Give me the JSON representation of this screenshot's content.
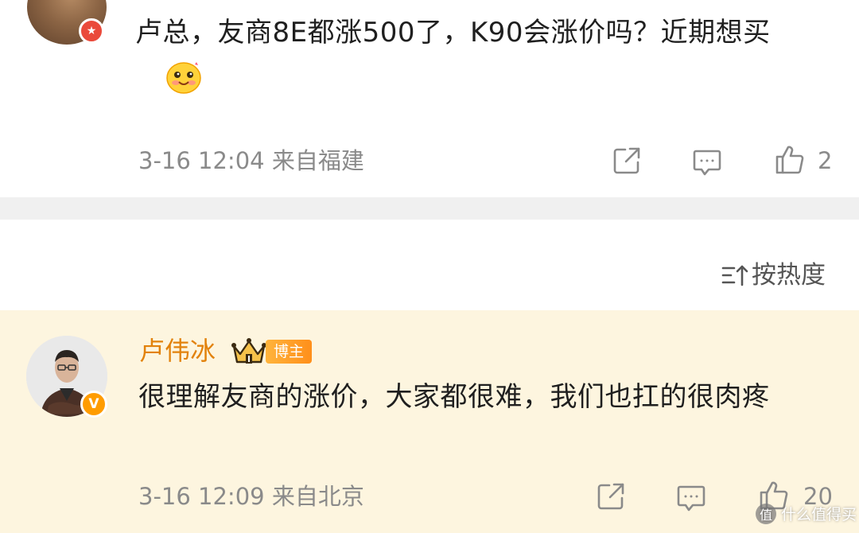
{
  "comments": [
    {
      "text": "卢总，友商8E都涨500了，K90会涨价吗？近期想买",
      "badge_icon": "star-badge-icon",
      "emoji": "blushing-smile-emoji",
      "meta": "3-16 12:04 来自福建",
      "like_count": "2"
    },
    {
      "author": "卢伟冰",
      "author_color": "#e2820c",
      "role_tag": "博主",
      "badge_icon": "verified-v-icon",
      "badge_letter": "V",
      "text": "很理解友商的涨价，大家都很难，我们也扛的很肉疼",
      "meta": "3-16 12:09 来自北京",
      "like_count": "20"
    }
  ],
  "sort": {
    "label": "按热度"
  },
  "watermark": {
    "logo": "值",
    "text": "什么值得买"
  },
  "colors": {
    "highlight_background": "#fdf5df",
    "separator": "#f0f0f0",
    "meta_text": "#8a8a8a",
    "body_text": "#1f1f1f",
    "badge_red": "#ea4a3b",
    "badge_orange": "#ff9c00"
  }
}
